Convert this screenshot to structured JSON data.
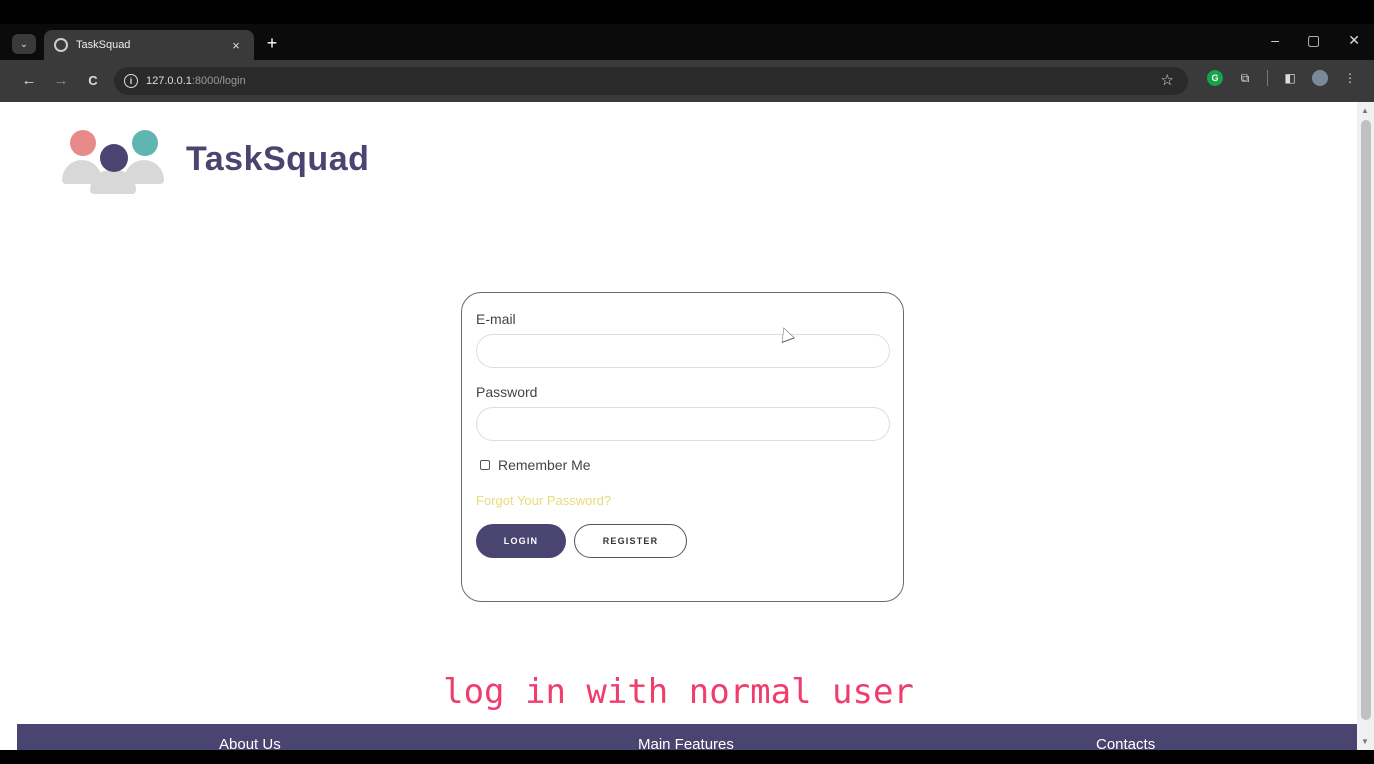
{
  "browser": {
    "tab_title": "TaskSquad",
    "tab_close": "×",
    "new_tab": "+",
    "url_host": "127.0.0.1",
    "url_rest": ":8000/login",
    "window_controls": [
      "–",
      "▢",
      "✕"
    ],
    "nav": {
      "back": "←",
      "forward": "→",
      "reload": "C"
    },
    "extensions": [
      "G",
      "⧉",
      "◧"
    ]
  },
  "page": {
    "brand_name": "TaskSquad",
    "form": {
      "email_label": "E-mail",
      "email_value": "",
      "password_label": "Password",
      "password_value": "",
      "remember_label": "Remember Me",
      "remember_checked": false,
      "forgot_link": "Forgot Your Password?",
      "login_button": "LOGIN",
      "register_button": "REGISTER"
    },
    "caption": "log in with normal user",
    "footer": {
      "about": "About Us",
      "features": "Main Features",
      "contacts": "Contacts"
    }
  },
  "colors": {
    "brand": "#4a4470",
    "forgot_link": "#e8dc7a",
    "caption": "#ef3d6e",
    "logo_left": "#e88a8a",
    "logo_center": "#4a4470",
    "logo_right": "#5fb5b0"
  }
}
